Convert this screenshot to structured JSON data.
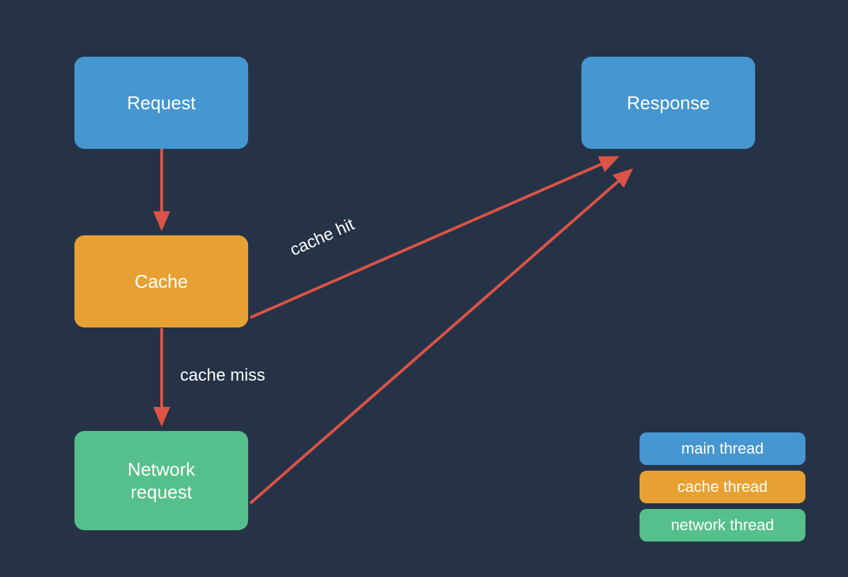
{
  "nodes": {
    "request": {
      "label": "Request",
      "color": "blue"
    },
    "cache": {
      "label": "Cache",
      "color": "orange"
    },
    "network": {
      "label": "Network\nrequest",
      "color": "green"
    },
    "response": {
      "label": "Response",
      "color": "blue"
    }
  },
  "edges": {
    "request_to_cache": {
      "label": ""
    },
    "cache_to_network": {
      "label": "cache miss"
    },
    "cache_to_response": {
      "label": "cache hit"
    },
    "network_to_response": {
      "label": ""
    }
  },
  "legend": [
    {
      "label": "main thread",
      "color": "blue"
    },
    {
      "label": "cache thread",
      "color": "orange"
    },
    {
      "label": "network thread",
      "color": "green"
    }
  ],
  "colors": {
    "blue": "#4596d1",
    "orange": "#e7a133",
    "green": "#55c08b",
    "arrow": "#dc5347",
    "bg": "#263347",
    "text": "#ffffff"
  }
}
